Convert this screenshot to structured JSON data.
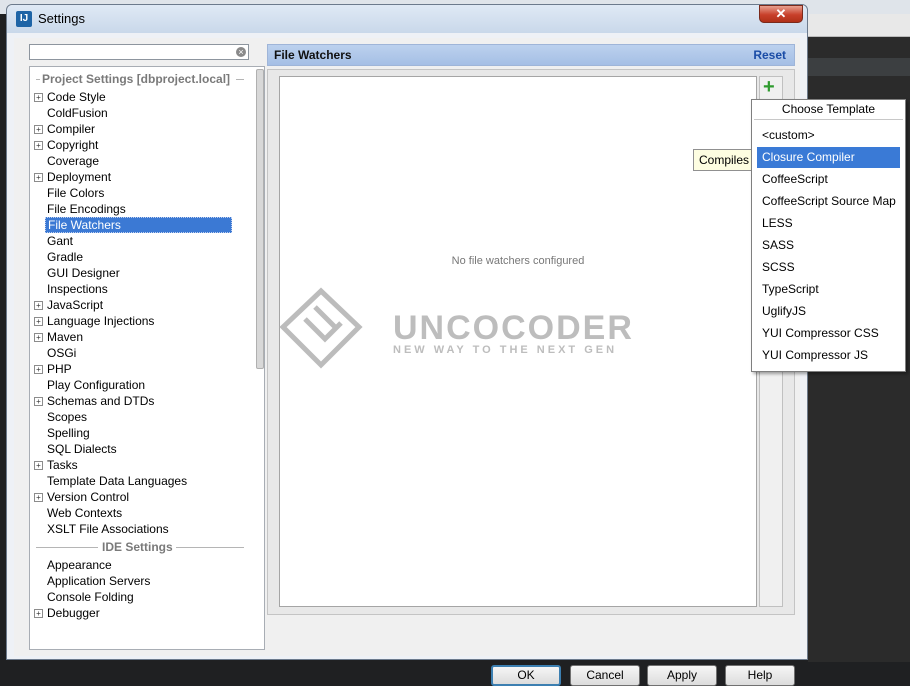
{
  "window": {
    "title": "Settings",
    "app_icon_text": "IJ",
    "close_symbol": "✕"
  },
  "search": {
    "value": "",
    "placeholder": ""
  },
  "tree": {
    "project_section": "Project Settings [dbproject.local]",
    "project_items": [
      {
        "label": "Code Style",
        "expandable": true
      },
      {
        "label": "ColdFusion",
        "expandable": false
      },
      {
        "label": "Compiler",
        "expandable": true
      },
      {
        "label": "Copyright",
        "expandable": true
      },
      {
        "label": "Coverage",
        "expandable": false
      },
      {
        "label": "Deployment",
        "expandable": true
      },
      {
        "label": "File Colors",
        "expandable": false
      },
      {
        "label": "File Encodings",
        "expandable": false
      },
      {
        "label": "File Watchers",
        "expandable": false,
        "selected": true
      },
      {
        "label": "Gant",
        "expandable": false
      },
      {
        "label": "Gradle",
        "expandable": false
      },
      {
        "label": "GUI Designer",
        "expandable": false
      },
      {
        "label": "Inspections",
        "expandable": false
      },
      {
        "label": "JavaScript",
        "expandable": true
      },
      {
        "label": "Language Injections",
        "expandable": true
      },
      {
        "label": "Maven",
        "expandable": true
      },
      {
        "label": "OSGi",
        "expandable": false
      },
      {
        "label": "PHP",
        "expandable": true
      },
      {
        "label": "Play Configuration",
        "expandable": false
      },
      {
        "label": "Schemas and DTDs",
        "expandable": true
      },
      {
        "label": "Scopes",
        "expandable": false
      },
      {
        "label": "Spelling",
        "expandable": false
      },
      {
        "label": "SQL Dialects",
        "expandable": false
      },
      {
        "label": "Tasks",
        "expandable": true
      },
      {
        "label": "Template Data Languages",
        "expandable": false
      },
      {
        "label": "Version Control",
        "expandable": true
      },
      {
        "label": "Web Contexts",
        "expandable": false
      },
      {
        "label": "XSLT File Associations",
        "expandable": false
      }
    ],
    "ide_section": "IDE Settings",
    "ide_items": [
      {
        "label": "Appearance",
        "expandable": false
      },
      {
        "label": "Application Servers",
        "expandable": false
      },
      {
        "label": "Console Folding",
        "expandable": false
      },
      {
        "label": "Debugger",
        "expandable": true
      }
    ]
  },
  "panel": {
    "title": "File Watchers",
    "reset_label": "Reset",
    "empty_text": "No file watchers configured",
    "add_symbol": "+"
  },
  "watermark": {
    "brand": "UNCOCODER",
    "tagline": "NEW WAY TO THE NEXT GEN"
  },
  "tooltip": {
    "text": "Compiles"
  },
  "popup": {
    "title": "Choose Template",
    "items": [
      {
        "label": "<custom>"
      },
      {
        "label": "Closure Compiler",
        "selected": true
      },
      {
        "label": "CoffeeScript"
      },
      {
        "label": "CoffeeScript Source Map"
      },
      {
        "label": "LESS"
      },
      {
        "label": "SASS"
      },
      {
        "label": "SCSS"
      },
      {
        "label": "TypeScript"
      },
      {
        "label": "UglifyJS"
      },
      {
        "label": "YUI Compressor CSS"
      },
      {
        "label": "YUI Compressor JS"
      }
    ]
  },
  "buttons": {
    "ok": "OK",
    "cancel": "Cancel",
    "apply": "Apply",
    "help": "Help"
  },
  "colors": {
    "selection": "#3b79d4",
    "header": "#bcd1ee",
    "reset_link": "#1a4ca6",
    "add_icon": "#2f9b2f"
  }
}
